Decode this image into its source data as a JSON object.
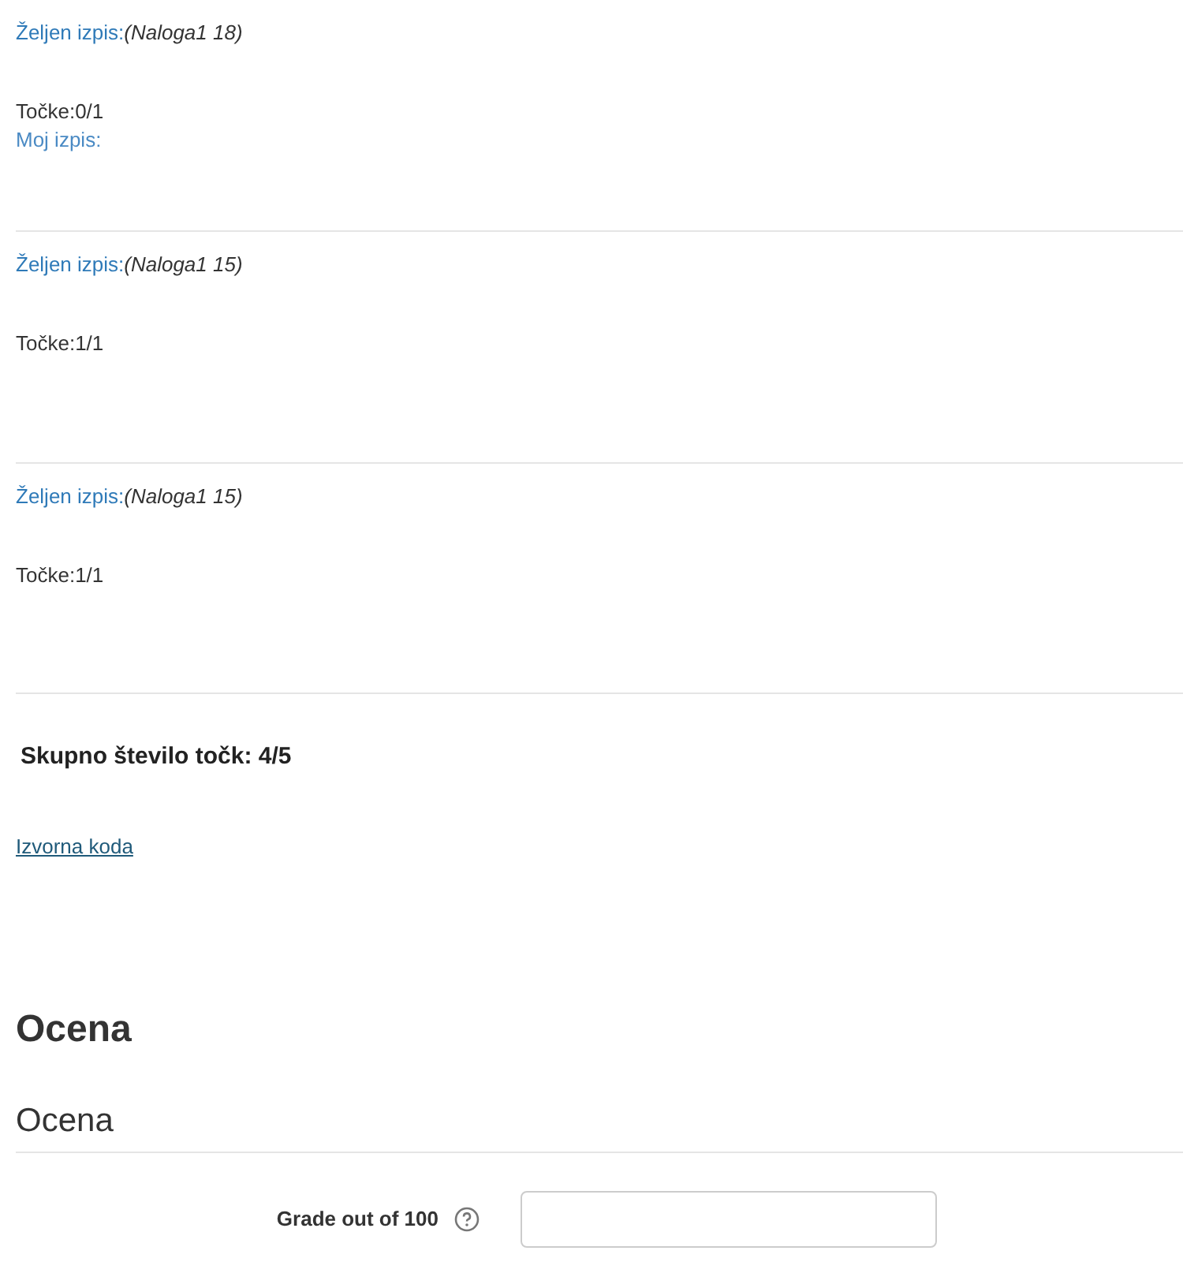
{
  "results": [
    {
      "expected_label": "Željen izpis:",
      "expected_value": "(Naloga1 18)",
      "points": "Točke:0/1",
      "my_output_label": "Moj izpis:"
    },
    {
      "expected_label": "Željen izpis:",
      "expected_value": "(Naloga1 15)",
      "points": "Točke:1/1"
    },
    {
      "expected_label": "Željen izpis:",
      "expected_value": "(Naloga1 15)",
      "points": "Točke:1/1"
    }
  ],
  "total": "Skupno število točk: 4/5",
  "source_link": "Izvorna koda",
  "grade_heading": "Ocena",
  "grade_section_title": "Ocena",
  "grade_field": {
    "label": "Grade out of 100"
  }
}
